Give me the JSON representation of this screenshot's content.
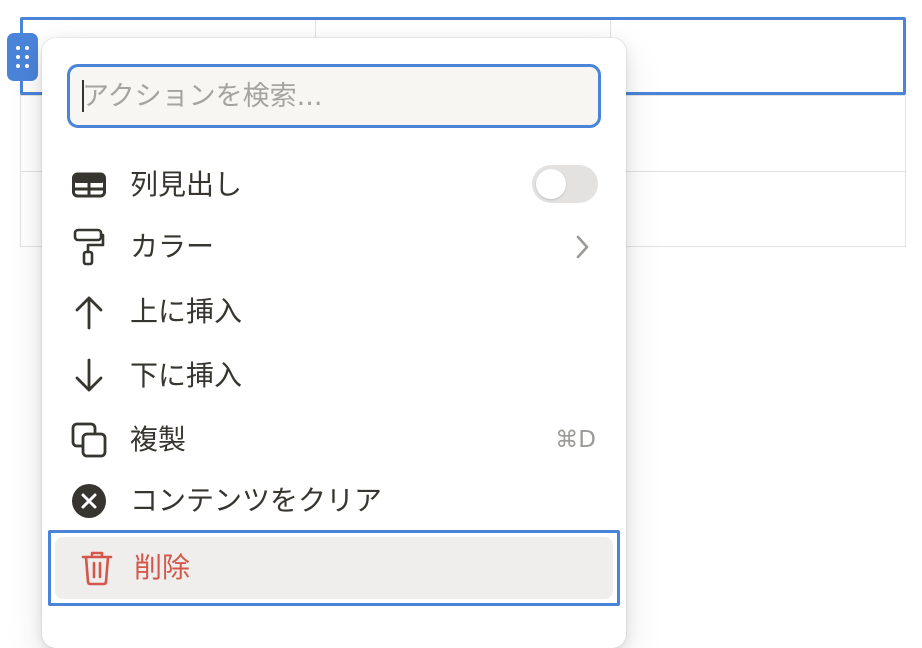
{
  "colors": {
    "accent": "#4a84d9",
    "danger": "#d4584a",
    "text": "#37352f",
    "muted": "#9b9a97",
    "hover_background": "#efeeec"
  },
  "search": {
    "placeholder": "アクションを検索..."
  },
  "menu": {
    "items": [
      {
        "label": "列見出し",
        "icon": "table-header-icon",
        "control": "toggle",
        "toggle_on": false
      },
      {
        "label": "カラー",
        "icon": "paint-roller-icon",
        "control": "chevron-right-icon"
      },
      {
        "label": "上に挿入",
        "icon": "arrow-up-icon"
      },
      {
        "label": "下に挿入",
        "icon": "arrow-down-icon"
      },
      {
        "label": "複製",
        "icon": "duplicate-icon",
        "shortcut": "⌘D"
      },
      {
        "label": "コンテンツをクリア",
        "icon": "clear-x-circle-icon"
      },
      {
        "label": "削除",
        "icon": "trash-icon",
        "style": "danger",
        "highlighted": true
      }
    ]
  }
}
